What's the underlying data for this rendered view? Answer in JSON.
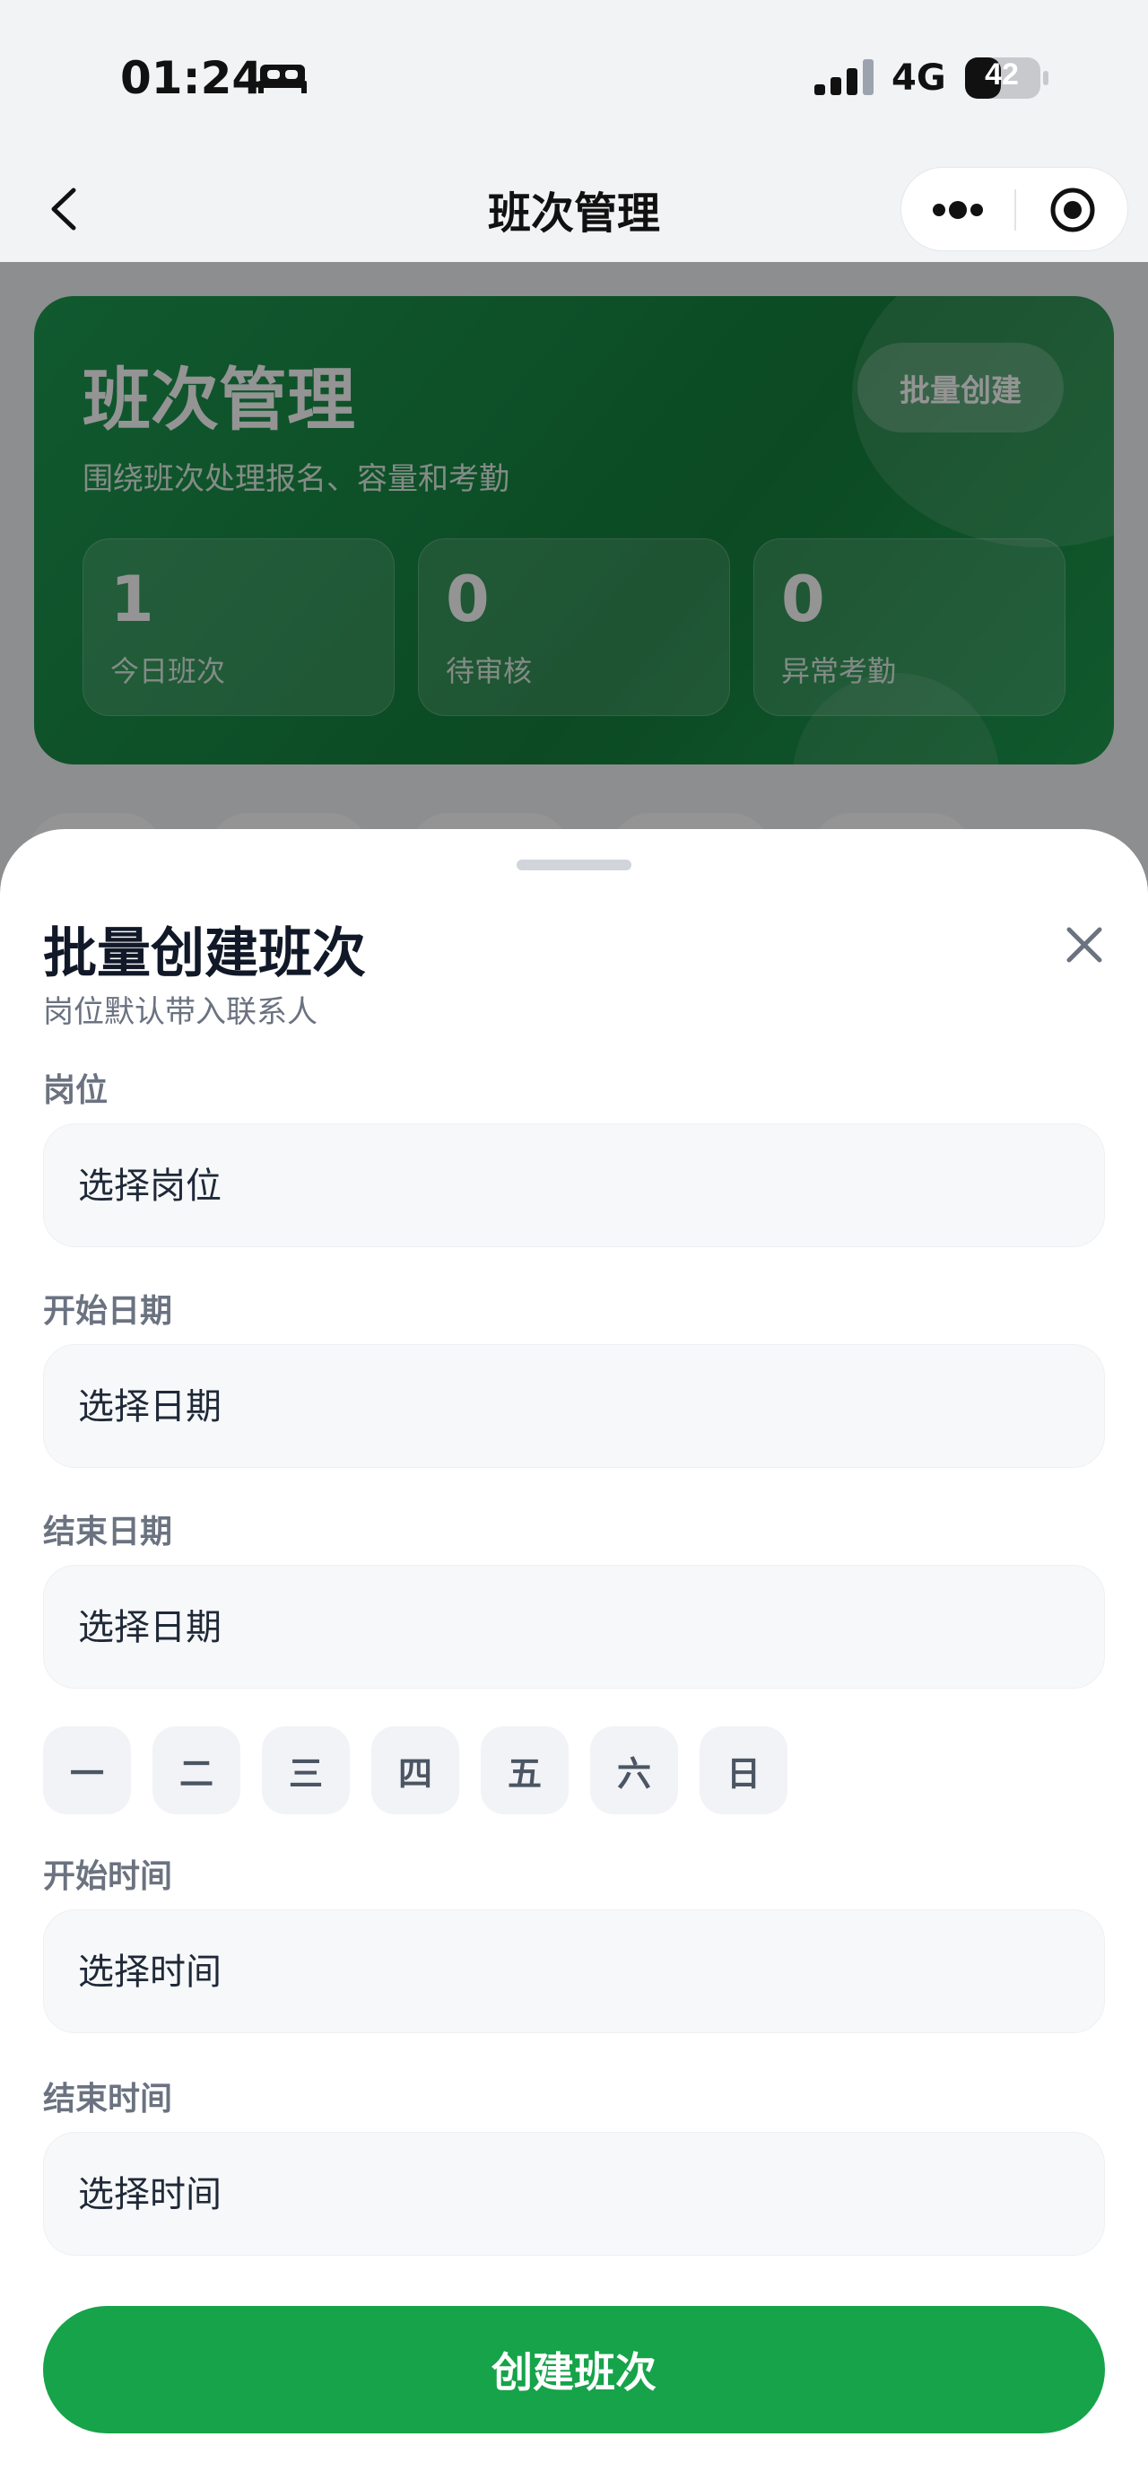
{
  "status_bar": {
    "time": "01:24",
    "network": "4G",
    "battery": "42"
  },
  "nav": {
    "title": "班次管理"
  },
  "hero": {
    "title": "班次管理",
    "subtitle": "围绕班次处理报名、容量和考勤",
    "batch_button": "批量创建",
    "stats": [
      {
        "value": "1",
        "label": "今日班次"
      },
      {
        "value": "0",
        "label": "待审核"
      },
      {
        "value": "0",
        "label": "异常考勤"
      }
    ]
  },
  "sheet": {
    "title": "批量创建班次",
    "subtitle": "岗位默认带入联系人",
    "fields": {
      "position": {
        "label": "岗位",
        "placeholder": "选择岗位"
      },
      "start_date": {
        "label": "开始日期",
        "placeholder": "选择日期"
      },
      "end_date": {
        "label": "结束日期",
        "placeholder": "选择日期"
      },
      "start_time": {
        "label": "开始时间",
        "placeholder": "选择时间"
      },
      "end_time": {
        "label": "结束时间",
        "placeholder": "选择时间"
      }
    },
    "weekdays": [
      "一",
      "二",
      "三",
      "四",
      "五",
      "六",
      "日"
    ],
    "submit_label": "创建班次"
  },
  "colors": {
    "brand_green": "#16a34a",
    "hero_green": "#15803d"
  },
  "icons": [
    "sleep-icon",
    "signal-icon",
    "battery-icon",
    "back-icon",
    "more-icon",
    "target-icon",
    "close-icon"
  ]
}
